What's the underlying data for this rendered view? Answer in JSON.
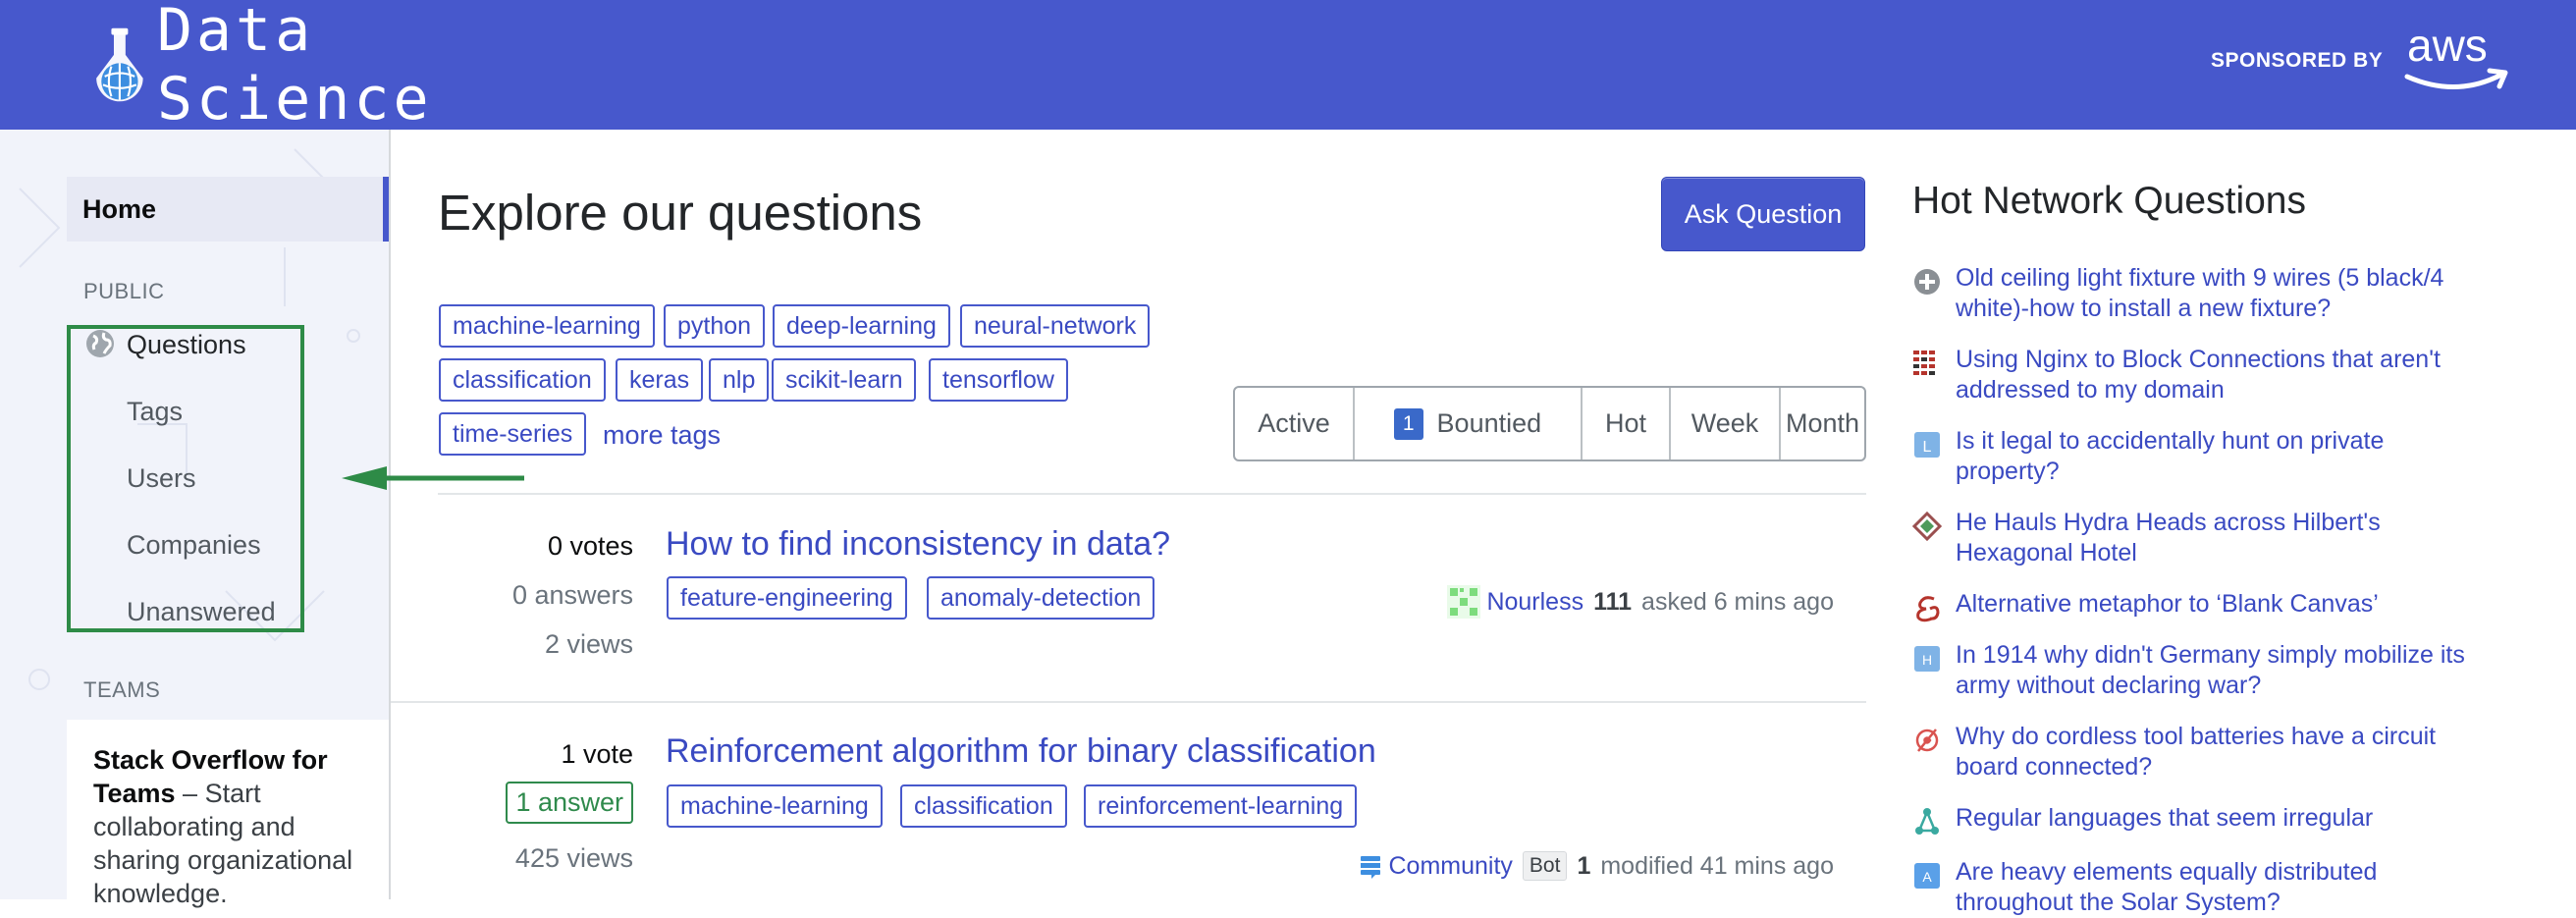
{
  "header": {
    "site_name": "Data Science",
    "sponsor_label": "SPONSORED BY",
    "sponsor_name": "aws",
    "brand_color": "#4758cc"
  },
  "sidebar": {
    "home": "Home",
    "public_label": "PUBLIC",
    "items": [
      {
        "label": "Questions",
        "icon": "globe-icon"
      },
      {
        "label": "Tags"
      },
      {
        "label": "Users"
      },
      {
        "label": "Companies"
      },
      {
        "label": "Unanswered"
      }
    ],
    "teams_label": "TEAMS",
    "teams_card": {
      "title": "Stack Overflow for Teams",
      "text": " – Start collaborating and sharing organizational knowledge."
    },
    "highlight_color": "#2e8b47"
  },
  "main": {
    "title": "Explore our questions",
    "ask_button": "Ask Question",
    "tags": [
      "machine-learning",
      "python",
      "deep-learning",
      "neural-network",
      "classification",
      "keras",
      "nlp",
      "scikit-learn",
      "tensorflow",
      "time-series"
    ],
    "more_tags": "more tags",
    "filters": [
      {
        "label": "Active"
      },
      {
        "label": "Bountied",
        "badge": "1"
      },
      {
        "label": "Hot"
      },
      {
        "label": "Week"
      },
      {
        "label": "Month"
      }
    ],
    "questions": [
      {
        "votes": "0 votes",
        "answers": "0 answers",
        "views": "2 views",
        "title": "How to find inconsistency in data?",
        "tags": [
          "feature-engineering",
          "anomaly-detection"
        ],
        "user": "Nourless",
        "rep": "111",
        "action": "asked 6 mins ago"
      },
      {
        "votes": "1 vote",
        "answers": "1 answer",
        "views": "425 views",
        "title": "Reinforcement algorithm for binary classification",
        "tags": [
          "machine-learning",
          "classification",
          "reinforcement-learning"
        ],
        "user": "Community",
        "bot": "Bot",
        "rep": "1",
        "action": "modified 41 mins ago"
      }
    ]
  },
  "hot_network": {
    "title": "Hot Network Questions",
    "items": [
      {
        "text": "Old ceiling light fixture with 9 wires (5 black/4 white)-how to install a new fixture?",
        "icon": "diy-site-icon"
      },
      {
        "text": "Using Nginx to Block Connections that aren't addressed to my domain",
        "icon": "server-fault-icon"
      },
      {
        "text": "Is it legal to accidentally hunt on private property?",
        "icon": "law-site-icon"
      },
      {
        "text": "He Hauls Hydra Heads across Hilbert's Hexagonal Hotel",
        "icon": "puzzling-site-icon"
      },
      {
        "text": "Alternative metaphor to ‘Blank Canvas’",
        "icon": "english-site-icon"
      },
      {
        "text": "In 1914 why didn't Germany simply mobilize its army without declaring war?",
        "icon": "history-site-icon"
      },
      {
        "text": "Why do cordless tool batteries have a circuit board connected?",
        "icon": "electronics-site-icon"
      },
      {
        "text": "Regular languages that seem irregular",
        "icon": "cs-site-icon"
      },
      {
        "text": "Are heavy elements equally distributed throughout the Solar System?",
        "icon": "astronomy-site-icon"
      }
    ]
  }
}
